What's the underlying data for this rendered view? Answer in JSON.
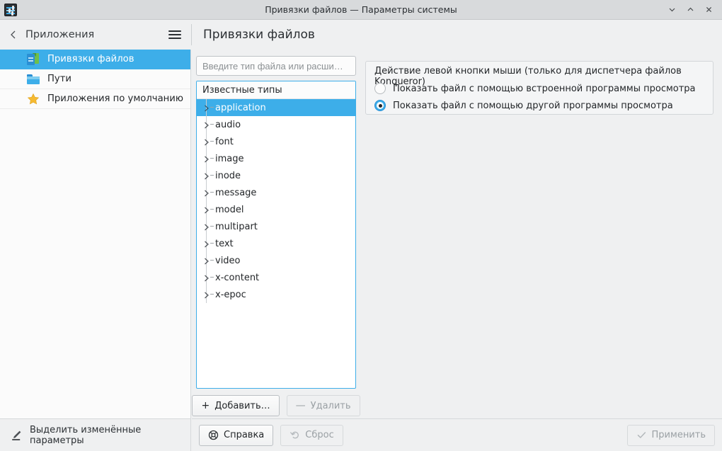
{
  "window": {
    "title": "Привязки файлов — Параметры системы",
    "app_icon": "system-settings-icon",
    "controls": {
      "minimize": "minimize-button",
      "maximize": "maximize-button",
      "close": "close-button"
    }
  },
  "header": {
    "back_label": "Приложения",
    "menu_icon": "hamburger-menu-icon",
    "page_title": "Привязки файлов"
  },
  "sidebar": {
    "items": [
      {
        "label": "Привязки файлов",
        "icon": "file-associations-icon",
        "selected": true
      },
      {
        "label": "Пути",
        "icon": "folder-icon",
        "selected": false
      },
      {
        "label": "Приложения по умолчанию",
        "icon": "star-icon",
        "selected": false
      }
    ]
  },
  "status": {
    "highlight_changed_label": "Выделить изменённые параметры",
    "highlight_icon": "highlighter-pen-icon"
  },
  "main": {
    "search": {
      "placeholder": "Введите тип файла или расши…",
      "value": ""
    },
    "tree": {
      "header": "Известные типы",
      "items": [
        {
          "label": "application",
          "selected": true
        },
        {
          "label": "audio",
          "selected": false
        },
        {
          "label": "font",
          "selected": false
        },
        {
          "label": "image",
          "selected": false
        },
        {
          "label": "inode",
          "selected": false
        },
        {
          "label": "message",
          "selected": false
        },
        {
          "label": "model",
          "selected": false
        },
        {
          "label": "multipart",
          "selected": false
        },
        {
          "label": "text",
          "selected": false
        },
        {
          "label": "video",
          "selected": false
        },
        {
          "label": "x-content",
          "selected": false
        },
        {
          "label": "x-epoc",
          "selected": false
        }
      ]
    },
    "list_buttons": {
      "add_label": "Добавить…",
      "add_glyph": "+",
      "remove_label": "Удалить",
      "remove_glyph": "—",
      "remove_disabled": true
    },
    "groupbox": {
      "title": "Действие левой кнопки мыши (только для диспетчера файлов Konqueror)",
      "options": [
        {
          "label": "Показать файл с помощью встроенной программы просмотра",
          "checked": false
        },
        {
          "label": "Показать файл с помощью другой программы просмотра",
          "checked": true
        }
      ]
    }
  },
  "footer": {
    "help_label": "Справка",
    "help_icon": "help-lifering-icon",
    "reset_label": "Сброс",
    "reset_icon": "undo-arrow-icon",
    "reset_disabled": true,
    "apply_label": "Применить",
    "apply_icon": "checkmark-icon",
    "apply_disabled": true
  },
  "colors": {
    "accent": "#3daee9",
    "window_bg": "#eff0f1",
    "titlebar_bg": "#d8dadc",
    "panel_bg": "#ffffff",
    "text": "#232629",
    "disabled_text": "#9aa0a4"
  }
}
